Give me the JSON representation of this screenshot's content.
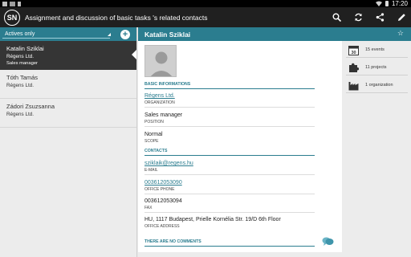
{
  "status_bar": {
    "time": "17:20"
  },
  "action_bar": {
    "logo_text": "SN",
    "title": "Assignment and discussion of basic tasks 's related contacts"
  },
  "filter": {
    "label": "Actives only",
    "add_label": "+"
  },
  "contacts": [
    {
      "name": "Katalin Sziklai",
      "organization": "Régens Ltd.",
      "position": "Sales manager"
    },
    {
      "name": "Tóth Tamás",
      "organization": "Régens Ltd.",
      "position": ""
    },
    {
      "name": "Zádori Zsuzsanna",
      "organization": "Régens Ltd.",
      "position": ""
    }
  ],
  "detail": {
    "name": "Katalin Sziklai",
    "sections": {
      "basic": "BASIC INFORMATIONS",
      "contacts": "CONTACTS",
      "comments": "THERE ARE NO COMMENTS"
    },
    "basic_fields": [
      {
        "value": "Régens Ltd.",
        "label": "ORGANIZATION"
      },
      {
        "value": "Sales manager",
        "label": "POSITION"
      },
      {
        "value": "Normal",
        "label": "SCOPE"
      }
    ],
    "contact_fields": [
      {
        "value": "sziklaik@regens.hu",
        "label": "E-MAIL"
      },
      {
        "value": "003612053090",
        "label": "OFFICE PHONE"
      },
      {
        "value": "003612053094",
        "label": "FAX"
      },
      {
        "value": "HU, 1117 Budapest, Prielle Kornélia Str. 19/D  6th Floor",
        "label": "OFFICE ADDRESS"
      }
    ]
  },
  "stats": [
    {
      "icon": "calendar-icon",
      "label": "15 events",
      "badge": "30"
    },
    {
      "icon": "puzzle-icon",
      "label": "11 projects"
    },
    {
      "icon": "factory-icon",
      "label": "1 organization"
    }
  ],
  "colors": {
    "accent": "#2b7d8f",
    "action_bar": "#202020",
    "selected": "#353535"
  }
}
